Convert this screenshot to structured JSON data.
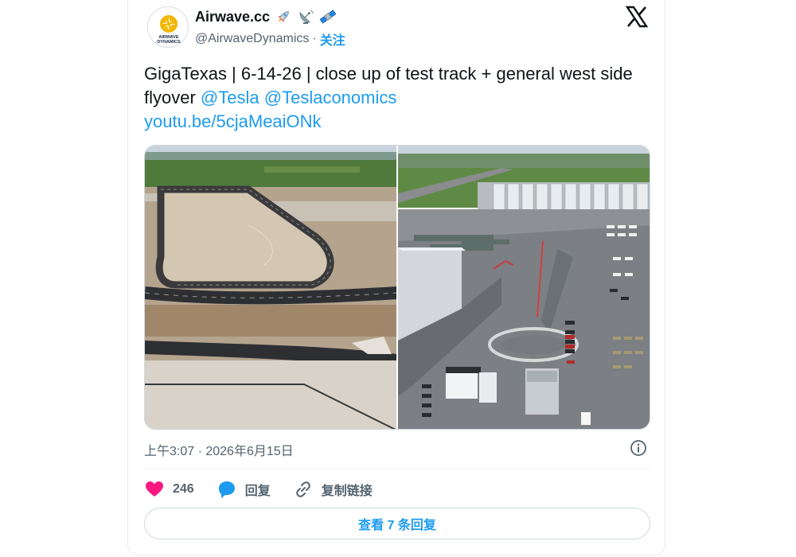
{
  "author": {
    "name": "Airwave.cc",
    "handle": "@AirwaveDynamics",
    "separator": "·",
    "follow_label": "关注",
    "avatar_text_line1": "AIRWAVE",
    "avatar_text_line2": "DYNAMICS",
    "emojis": [
      "rocket-icon",
      "satellite-antenna-icon",
      "satellite-icon"
    ]
  },
  "tweet": {
    "text_part1": "GigaTexas | 6-14-26 | close up of test track + general west side flyover",
    "mention1": "@Tesla",
    "mention2": "@Teslaconomics",
    "link": "youtu.be/5cjaMeaiONk",
    "timestamp": "上午3:07 · 2026年6月15日"
  },
  "media": [
    {
      "subject": "aerial-test-track-photo"
    },
    {
      "subject": "aerial-parking-lot-photo"
    }
  ],
  "actions": {
    "like_count": "246",
    "reply_label": "回复",
    "copy_link_label": "复制链接"
  },
  "replies_button_label": "查看 7 条回复",
  "colors": {
    "accent": "#1d9bf0",
    "like": "#f91880",
    "text": "#0f1419",
    "muted": "#536471"
  }
}
